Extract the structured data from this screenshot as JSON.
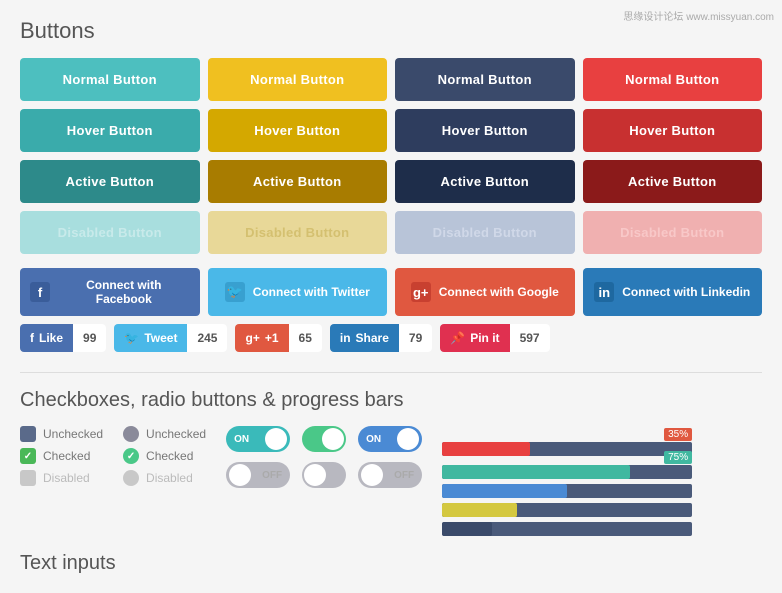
{
  "page": {
    "watermark": "思缘设计论坛 www.missyuan.com",
    "buttons_title": "Buttons",
    "checks_title": "Checkboxes, radio buttons & progress bars",
    "inputs_title": "Text inputs"
  },
  "buttons": {
    "row1": [
      {
        "label": "Normal Button",
        "style": "green-normal"
      },
      {
        "label": "Normal Button",
        "style": "yellow-normal"
      },
      {
        "label": "Normal Button",
        "style": "navy-normal"
      },
      {
        "label": "Normal Button",
        "style": "red-normal"
      }
    ],
    "row2": [
      {
        "label": "Hover Button",
        "style": "green-hover"
      },
      {
        "label": "Hover Button",
        "style": "yellow-hover"
      },
      {
        "label": "Hover Button",
        "style": "navy-hover"
      },
      {
        "label": "Hover Button",
        "style": "red-hover"
      }
    ],
    "row3": [
      {
        "label": "Active Button",
        "style": "green-active"
      },
      {
        "label": "Active Button",
        "style": "yellow-active"
      },
      {
        "label": "Active Button",
        "style": "navy-active"
      },
      {
        "label": "Active Button",
        "style": "red-active"
      }
    ],
    "row4": [
      {
        "label": "Disabled Button",
        "style": "green-disabled"
      },
      {
        "label": "Disabled Button",
        "style": "yellow-disabled"
      },
      {
        "label": "Disabled Button",
        "style": "navy-disabled"
      },
      {
        "label": "Disabled Button",
        "style": "red-disabled"
      }
    ]
  },
  "social": {
    "buttons": [
      {
        "label": "Connect with Facebook",
        "icon": "f",
        "style": "facebook"
      },
      {
        "label": "Connect with Twitter",
        "icon": "🐦",
        "style": "twitter"
      },
      {
        "label": "Connect with Google",
        "icon": "g+",
        "style": "google"
      },
      {
        "label": "Connect with Linkedin",
        "icon": "in",
        "style": "linkedin"
      }
    ]
  },
  "share": {
    "buttons": [
      {
        "icon": "f",
        "label": "Like",
        "count": "99",
        "style": "fb"
      },
      {
        "icon": "🐦",
        "label": "Tweet",
        "count": "245",
        "style": "tw"
      },
      {
        "icon": "g+",
        "label": "+1",
        "count": "65",
        "style": "gp"
      },
      {
        "icon": "in",
        "label": "Share",
        "count": "79",
        "style": "li"
      },
      {
        "icon": "P",
        "label": "Pin it",
        "count": "597",
        "style": "pin"
      }
    ]
  },
  "checkboxes": {
    "square": [
      {
        "state": "unchecked",
        "label": "Unchecked"
      },
      {
        "state": "checked",
        "label": "Checked"
      },
      {
        "state": "disabled",
        "label": "Disabled"
      }
    ],
    "round": [
      {
        "state": "unchecked",
        "label": "Unchecked"
      },
      {
        "state": "checked",
        "label": "Checked"
      },
      {
        "state": "disabled",
        "label": "Disabled"
      }
    ]
  },
  "toggles": {
    "items": [
      {
        "type": "slider",
        "state": "on",
        "label_on": "ON",
        "label_off": "OFF"
      },
      {
        "type": "round",
        "state": "on"
      },
      {
        "type": "slider-blue",
        "state": "on",
        "label_on": "ON",
        "label_off": "OFF"
      }
    ],
    "off_items": [
      {
        "type": "slider",
        "state": "off",
        "label_on": "ON",
        "label_off": "OFF"
      },
      {
        "type": "round",
        "state": "off"
      },
      {
        "type": "slider-blue",
        "state": "off",
        "label_on": "ON",
        "label_off": "OFF"
      }
    ]
  },
  "progress": {
    "bars": [
      {
        "value": 35,
        "label": "35%",
        "color": "red"
      },
      {
        "value": 75,
        "label": "75%",
        "color": "green"
      },
      {
        "value": 50,
        "label": "",
        "color": "blue"
      },
      {
        "value": 30,
        "label": "",
        "color": "yellow"
      },
      {
        "value": 20,
        "label": "",
        "color": "dark"
      }
    ]
  }
}
